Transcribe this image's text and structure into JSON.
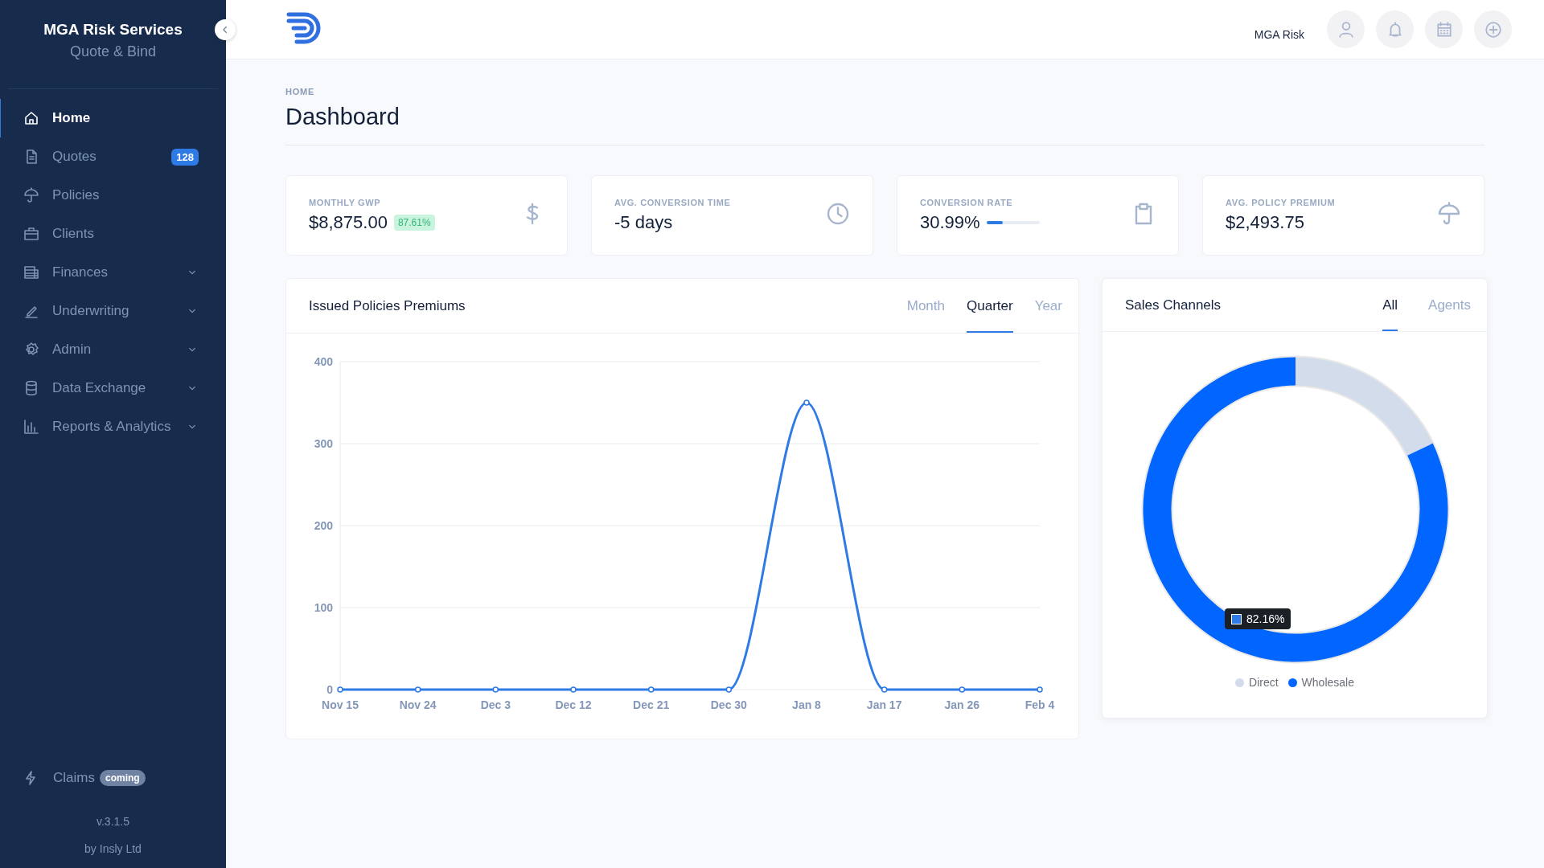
{
  "sidebar": {
    "title": "MGA Risk Services",
    "subtitle": "Quote & Bind",
    "items": [
      {
        "label": "Home",
        "selected": true,
        "expandable": false
      },
      {
        "label": "Quotes",
        "selected": false,
        "expandable": false,
        "badge": "128"
      },
      {
        "label": "Policies",
        "selected": false,
        "expandable": false
      },
      {
        "label": "Clients",
        "selected": false,
        "expandable": false
      },
      {
        "label": "Finances",
        "selected": false,
        "expandable": true
      },
      {
        "label": "Underwriting",
        "selected": false,
        "expandable": true
      },
      {
        "label": "Admin",
        "selected": false,
        "expandable": true
      },
      {
        "label": "Data Exchange",
        "selected": false,
        "expandable": true
      },
      {
        "label": "Reports & Analytics",
        "selected": false,
        "expandable": true
      }
    ],
    "claims": {
      "label": "Claims",
      "tag": "coming"
    },
    "version": "v.3.1.5",
    "credit": "by Insly Ltd"
  },
  "header": {
    "user": "MGA Risk"
  },
  "breadcrumb": "HOME",
  "page_title": "Dashboard",
  "stats": [
    {
      "label": "MONTHLY GWP",
      "value": "$8,875.00",
      "badge": "87.61%"
    },
    {
      "label": "AVG. CONVERSION TIME",
      "value": "-5 days"
    },
    {
      "label": "CONVERSION RATE",
      "value": "30.99%",
      "level": 0.31
    },
    {
      "label": "AVG. POLICY PREMIUM",
      "value": "$2,493.75"
    }
  ],
  "premiums": {
    "title": "Issued Policies Premiums",
    "tabs": [
      {
        "label": "Month",
        "selected": false
      },
      {
        "label": "Quarter",
        "selected": true
      },
      {
        "label": "Year",
        "selected": false
      }
    ],
    "chart_data": {
      "type": "line",
      "categories": [
        "Nov 15",
        "Nov 24",
        "Dec 3",
        "Dec 12",
        "Dec 21",
        "Dec 30",
        "Jan 8",
        "Jan 17",
        "Jan 26",
        "Feb 4"
      ],
      "series": [
        {
          "color": "#2f7be5",
          "marker": "circle",
          "values": [
            0,
            0,
            0,
            0,
            0,
            0,
            350,
            0,
            0,
            0
          ]
        }
      ],
      "ylim": [
        0,
        400
      ],
      "yticks": [
        0,
        100,
        200,
        300,
        400
      ],
      "grid": true
    }
  },
  "sales": {
    "title": "Sales Channels",
    "tabs": [
      {
        "label": "All",
        "selected": true
      },
      {
        "label": "Agents",
        "selected": false
      }
    ],
    "tooltip": "82.16%",
    "chart_data": {
      "type": "donut",
      "categories": [
        "Direct",
        "Wholesale"
      ],
      "series": [
        {
          "values": [
            17.84,
            82.16
          ]
        }
      ]
    },
    "legend": [
      {
        "color": "#d3dceb"
      },
      {
        "color": "#0066ff"
      }
    ]
  }
}
